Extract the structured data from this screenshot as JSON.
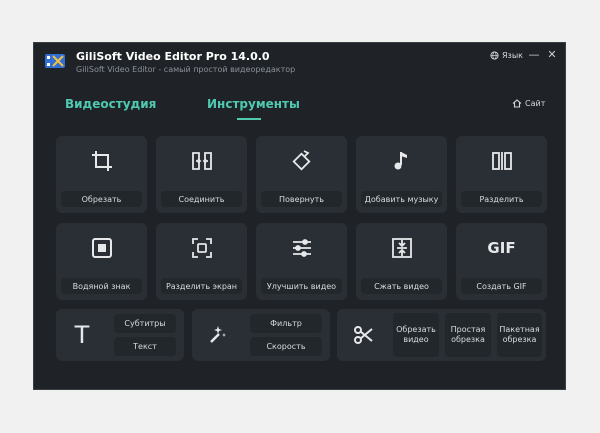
{
  "window": {
    "title": "GiliSoft Video Editor Pro 14.0.0",
    "subtitle": "GiliSoft Video Editor - самый простой видеоредактор",
    "language": "Язык",
    "minimize": "—",
    "close": "✕"
  },
  "tabs": [
    {
      "label": "Видеостудия",
      "active": false
    },
    {
      "label": "Инструменты",
      "active": true
    }
  ],
  "site_link": "Сайт",
  "tools": [
    {
      "label": "Обрезать",
      "icon": "crop-icon"
    },
    {
      "label": "Соединить",
      "icon": "merge-icon"
    },
    {
      "label": "Повернуть",
      "icon": "rotate-icon"
    },
    {
      "label": "Добавить музыку",
      "icon": "music-note-icon"
    },
    {
      "label": "Разделить",
      "icon": "split-icon"
    },
    {
      "label": "Водяной знак",
      "icon": "watermark-icon"
    },
    {
      "label": "Разделить экран",
      "icon": "split-screen-icon"
    },
    {
      "label": "Улучшить видео",
      "icon": "sliders-icon"
    },
    {
      "label": "Сжать видео",
      "icon": "compress-icon"
    },
    {
      "label": "Создать GIF",
      "icon": "gif-icon",
      "icon_text": "GIF"
    }
  ],
  "text_group": {
    "icon_text": "T",
    "subtitles": "Субтитры",
    "text": "Текст"
  },
  "effects_group": {
    "filter": "Фильтр",
    "speed": "Скорость"
  },
  "cut_group": {
    "cut_video": "Обрезать видео",
    "simple_cut": "Простая обрезка",
    "batch_cut": "Пакетная обрезка"
  },
  "colors": {
    "accent": "#4fc9b0",
    "window_bg": "#1f2328",
    "tile_bg": "#2a2f35",
    "label_bg": "#22272c"
  }
}
